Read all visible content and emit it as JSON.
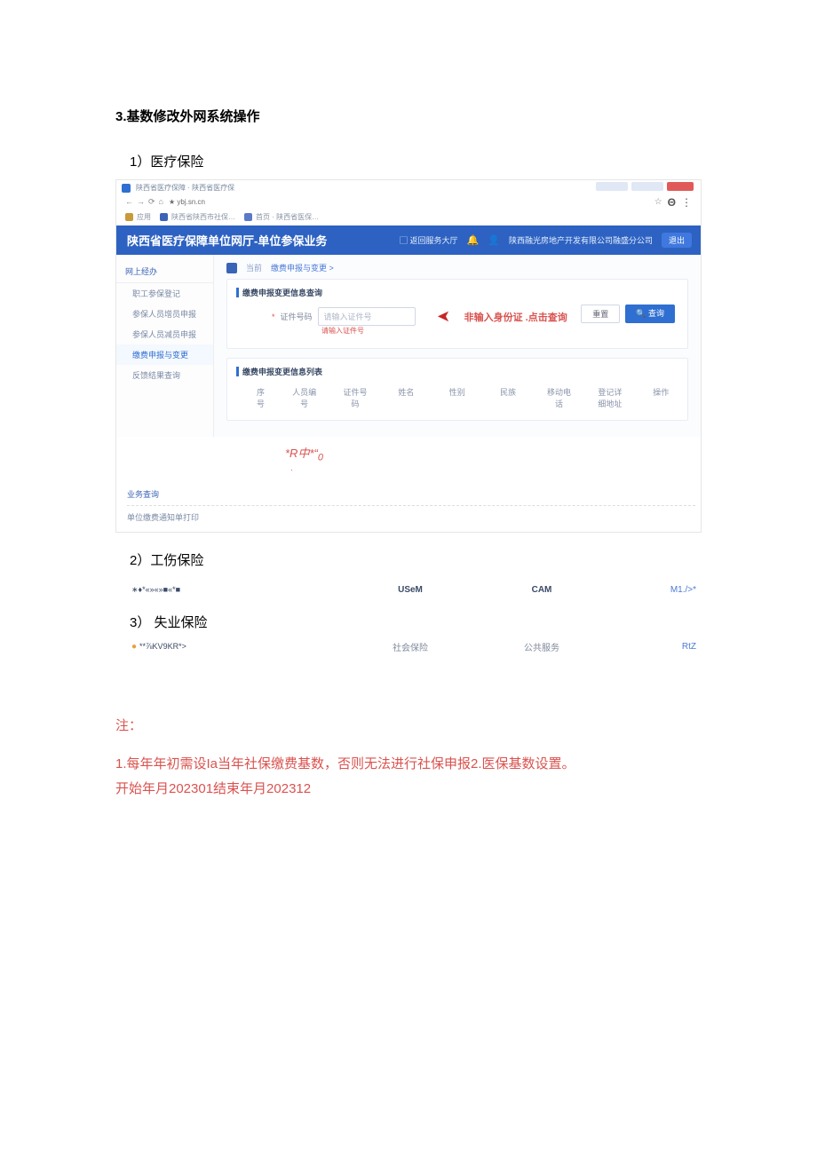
{
  "title": "3.基数修改外网系统操作",
  "sections": {
    "s1": {
      "title": "1）医疗保险"
    },
    "s2": {
      "title": "2）工伤保险"
    },
    "s3": {
      "title": "3） 失业保险"
    }
  },
  "browser": {
    "tab_title": "陕西省医疗保障 · 陕西省医疗保",
    "url_prefix": "★ ybj.sn.cn",
    "bookmarks": {
      "b1": "应用",
      "b2": "陕西省陕西市社保…",
      "b3": "首页 · 陕西省医保…"
    }
  },
  "header": {
    "title": "陕西省医疗保障单位网厅-单位参保业务",
    "link": "返回服务大厅",
    "company": "陕西融光房地产开发有限公司融盛分公司",
    "logout": "退出"
  },
  "sidebar": {
    "head": "网上经办",
    "items": [
      "职工参保登记",
      "参保人员增员申报",
      "参保人员减员申报",
      "缴费申报与变更",
      "反馈结果查询"
    ]
  },
  "crumb": {
    "home": "当前",
    "page": "缴费申报与变更 >"
  },
  "card1": {
    "title": "缴费申报变更信息查询",
    "field_label": "证件号码",
    "placeholder": "请输入证件号",
    "error": "请输入证件号",
    "hint": "非输入身份证 .点击查询",
    "btn_reset": "重置",
    "btn_query": "查询"
  },
  "card2": {
    "title": "缴费申报变更信息列表",
    "headers": [
      "序号",
      "人员编号",
      "证件号码",
      "姓名",
      "性别",
      "民族",
      "移动电话",
      "登记详细地址",
      "操作"
    ]
  },
  "red_mark": "*R中*“",
  "red_sub": "0",
  "bottom": {
    "b1": "业务查询",
    "b2": "单位缴费通知单打印"
  },
  "shot2": {
    "left": "∗♦*«»«»■«*■",
    "mid1": "USeM",
    "mid2": "CAM",
    "right": "M1./>*"
  },
  "shot3": {
    "left": "**⅞KV9KR*>",
    "mid1": "社会保险",
    "mid2": "公共服务",
    "right": "RtZ"
  },
  "notes": {
    "title": "注：",
    "body": "1.每年年初需设Ia当年社保缴费基数，否则无法进行社保申报2.医保基数设置。开始年月202301结束年月202312"
  }
}
